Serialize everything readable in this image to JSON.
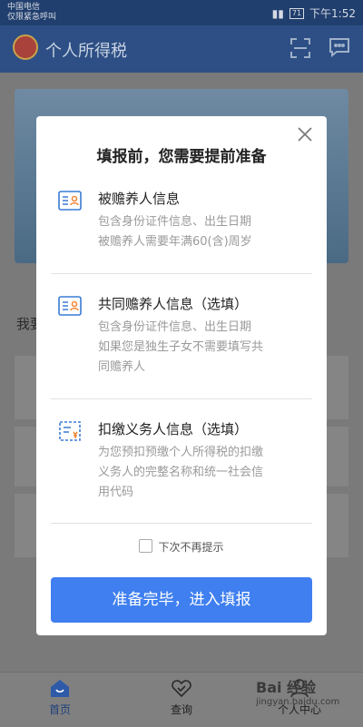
{
  "status_bar": {
    "carrier": "中国电信",
    "emergency": "仅限紧急呼叫",
    "battery": "71",
    "time": "下午1:52"
  },
  "app": {
    "title": "个人所得税",
    "section_label": "我要"
  },
  "modal": {
    "title": "填报前，您需要提前准备",
    "items": [
      {
        "icon": "id-card-icon",
        "title": "被赡养人信息",
        "desc_lines": [
          "包含身份证件信息、出生日期",
          "被赡养人需要年满60(含)周岁"
        ]
      },
      {
        "icon": "id-card-icon",
        "title": "共同赡养人信息（选填）",
        "desc_lines": [
          "包含身份证件信息、出生日期",
          "如果您是独生子女不需要填写共",
          "同赡养人"
        ]
      },
      {
        "icon": "tax-receipt-icon",
        "title": "扣缴义务人信息（选填）",
        "desc_lines": [
          "为您预扣预缴个人所得税的扣缴",
          "义务人的完整名称和统一社会信",
          "用代码"
        ]
      }
    ],
    "checkbox_label": "下次不再提示",
    "confirm_label": "准备完毕，进入填报"
  },
  "bottom_nav": {
    "home": "首页",
    "query": "查询",
    "personal": "个人中心"
  },
  "watermark": {
    "logo": "Bai 经验",
    "url": "jingyan.baidu.com"
  },
  "colors": {
    "primary_button": "#3f7ff0",
    "icon_blue": "#3a7bd5",
    "icon_orange": "#f08a3c"
  }
}
